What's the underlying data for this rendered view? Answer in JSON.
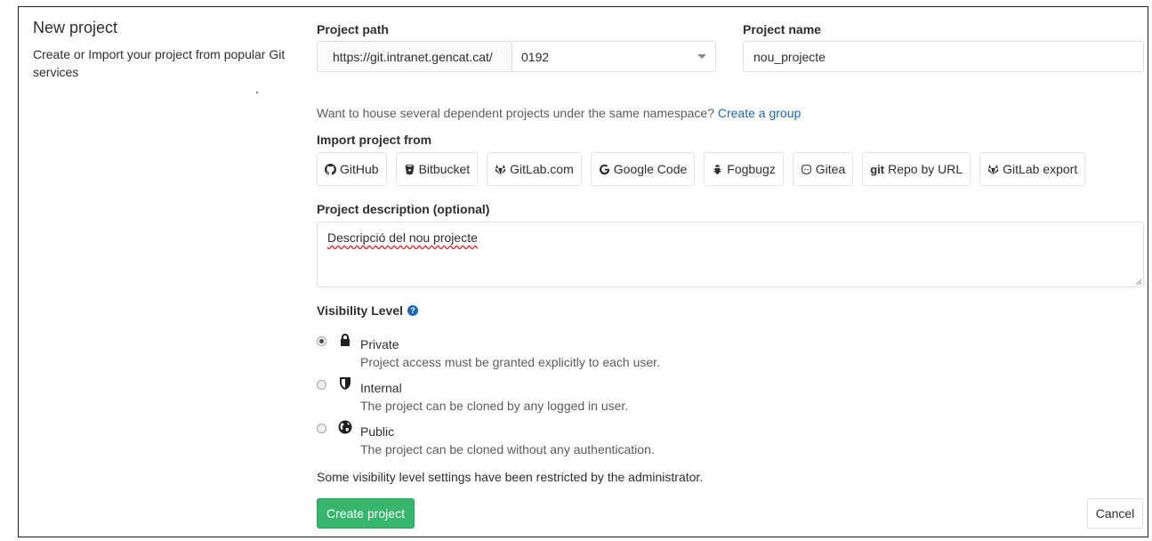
{
  "sidebar": {
    "title": "New project",
    "description": "Create or Import your project from popular Git services"
  },
  "path": {
    "label": "Project path",
    "prefix": "https://git.intranet.gencat.cat/",
    "namespace": "0192"
  },
  "name": {
    "label": "Project name",
    "value": "nou_projecte"
  },
  "group_hint": {
    "text": "Want to house several dependent projects under the same namespace?",
    "link": "Create a group"
  },
  "import": {
    "label": "Import project from",
    "sources": [
      {
        "label": "GitHub",
        "icon": "github-icon"
      },
      {
        "label": "Bitbucket",
        "icon": "bitbucket-icon"
      },
      {
        "label": "GitLab.com",
        "icon": "gitlab-icon"
      },
      {
        "label": "Google Code",
        "icon": "google-icon"
      },
      {
        "label": "Fogbugz",
        "icon": "bug-icon"
      },
      {
        "label": "Gitea",
        "icon": "gitea-icon"
      },
      {
        "label": "Repo by URL",
        "icon": "git-icon"
      },
      {
        "label": "GitLab export",
        "icon": "gitlab-icon"
      }
    ]
  },
  "description": {
    "label": "Project description (optional)",
    "value": "Descripció del nou projecte"
  },
  "visibility": {
    "label": "Visibility Level",
    "options": [
      {
        "title": "Private",
        "desc": "Project access must be granted explicitly to each user.",
        "icon": "lock-icon",
        "checked": true
      },
      {
        "title": "Internal",
        "desc": "The project can be cloned by any logged in user.",
        "icon": "shield-icon",
        "checked": false
      },
      {
        "title": "Public",
        "desc": "The project can be cloned without any authentication.",
        "icon": "globe-icon",
        "checked": false
      }
    ],
    "restricted_note": "Some visibility level settings have been restricted by the administrator."
  },
  "actions": {
    "create": "Create project",
    "cancel": "Cancel"
  },
  "colors": {
    "primary_button": "#37b56c",
    "link": "#1b69b6"
  }
}
